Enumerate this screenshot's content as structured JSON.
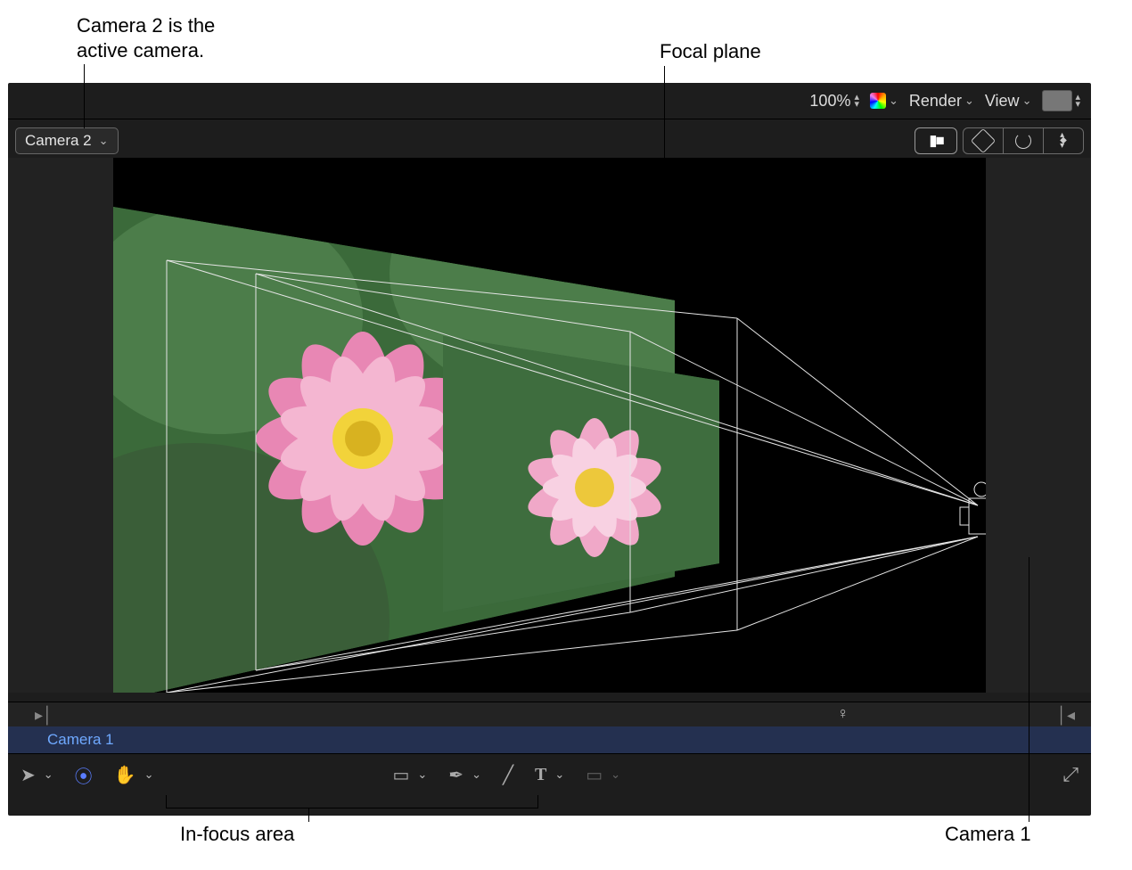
{
  "callouts": {
    "active_camera": "Camera 2 is the\nactive camera.",
    "focal_plane": "Focal plane",
    "in_focus_area": "In-focus area",
    "camera1": "Camera 1"
  },
  "top_toolbar": {
    "zoom": "100%",
    "render": "Render",
    "view": "View"
  },
  "viewer": {
    "camera_menu": "Camera 2"
  },
  "timeline": {
    "clip": "Camera 1"
  },
  "icons": {
    "cam": "▮■",
    "chev": "⌄",
    "arrow": "➤",
    "hand": "✋",
    "rect": "▭",
    "pen": "✒",
    "brush": "╱",
    "text": "T",
    "mask": "▭",
    "3d": "◈",
    "fit": "⤡",
    "playhead_in": "▶│",
    "playhead": "♀",
    "playhead_out": "│◀"
  }
}
